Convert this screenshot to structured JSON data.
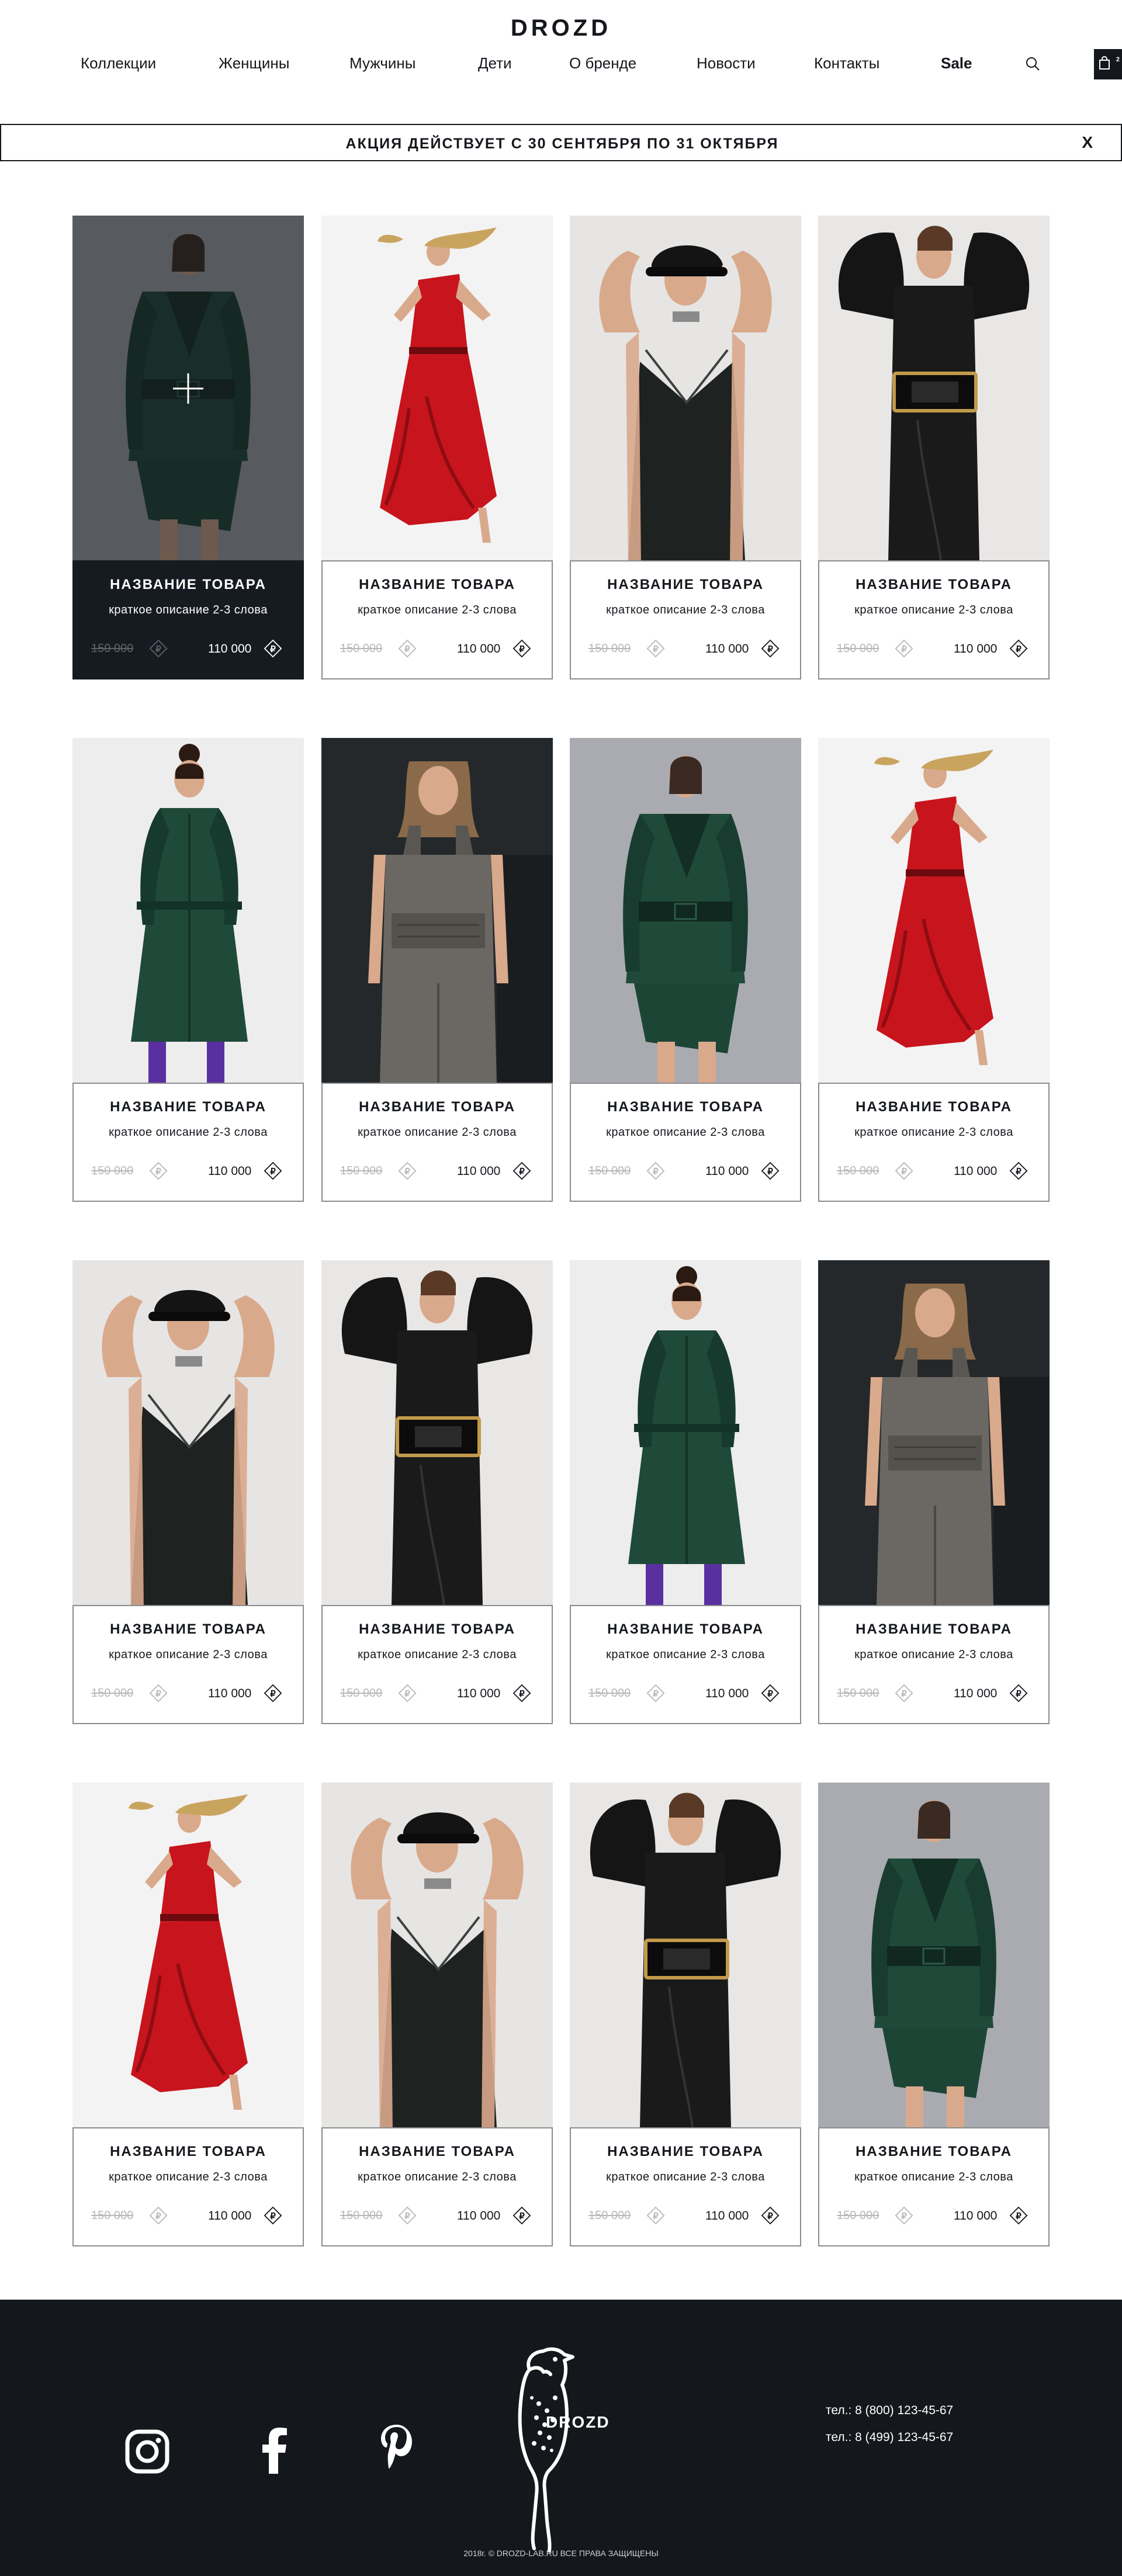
{
  "header": {
    "logo": "DROZD",
    "nav": [
      {
        "label": "Коллекции"
      },
      {
        "label": "Женщины"
      },
      {
        "label": "Мужчины"
      },
      {
        "label": "Дети"
      },
      {
        "label": "О бренде"
      },
      {
        "label": "Новости"
      },
      {
        "label": "Контакты"
      },
      {
        "label": "Sale"
      }
    ],
    "cart_count": "2"
  },
  "promo": {
    "text": "АКЦИЯ ДЕЙСТВУЕТ С 30 СЕНТЯБРЯ ПО 31 ОКТЯБРЯ",
    "close": "X"
  },
  "products": [
    {
      "title": "НАЗВАНИЕ ТОВАРА",
      "desc": "краткое описание 2-3 слова",
      "old_price": "150 000",
      "price": "110 000",
      "image": "green-leather-jacket-skirt"
    },
    {
      "title": "НАЗВАНИЕ ТОВАРА",
      "desc": "краткое описание 2-3 слова",
      "old_price": "150 000",
      "price": "110 000",
      "image": "red-leather-dress"
    },
    {
      "title": "НАЗВАНИЕ ТОВАРА",
      "desc": "краткое описание 2-3 слова",
      "old_price": "150 000",
      "price": "110 000",
      "image": "black-leather-slip-dress-cap"
    },
    {
      "title": "НАЗВАНИЕ ТОВАРА",
      "desc": "краткое описание 2-3 слова",
      "old_price": "150 000",
      "price": "110 000",
      "image": "black-leather-puff-sleeve-dress"
    },
    {
      "title": "НАЗВАНИЕ ТОВАРА",
      "desc": "краткое описание 2-3 слова",
      "old_price": "150 000",
      "price": "110 000",
      "image": "green-leather-trench-coat"
    },
    {
      "title": "НАЗВАНИЕ ТОВАРА",
      "desc": "краткое описание 2-3 слова",
      "old_price": "150 000",
      "price": "110 000",
      "image": "grey-leather-overalls"
    },
    {
      "title": "НАЗВАНИЕ ТОВАРА",
      "desc": "краткое описание 2-3 слова",
      "old_price": "150 000",
      "price": "110 000",
      "image": "green-leather-jacket-skirt"
    },
    {
      "title": "НАЗВАНИЕ ТОВАРА",
      "desc": "краткое описание 2-3 слова",
      "old_price": "150 000",
      "price": "110 000",
      "image": "red-leather-dress"
    },
    {
      "title": "НАЗВАНИЕ ТОВАРА",
      "desc": "краткое описание 2-3 слова",
      "old_price": "150 000",
      "price": "110 000",
      "image": "black-leather-slip-dress-cap"
    },
    {
      "title": "НАЗВАНИЕ ТОВАРА",
      "desc": "краткое описание 2-3 слова",
      "old_price": "150 000",
      "price": "110 000",
      "image": "black-leather-puff-sleeve-dress"
    },
    {
      "title": "НАЗВАНИЕ ТОВАРА",
      "desc": "краткое описание 2-3 слова",
      "old_price": "150 000",
      "price": "110 000",
      "image": "green-leather-trench-coat"
    },
    {
      "title": "НАЗВАНИЕ ТОВАРА",
      "desc": "краткое описание 2-3 слова",
      "old_price": "150 000",
      "price": "110 000",
      "image": "grey-leather-overalls"
    },
    {
      "title": "НАЗВАНИЕ ТОВАРА",
      "desc": "краткое описание 2-3 слова",
      "old_price": "150 000",
      "price": "110 000",
      "image": "red-leather-dress"
    },
    {
      "title": "НАЗВАНИЕ ТОВАРА",
      "desc": "краткое описание 2-3 слова",
      "old_price": "150 000",
      "price": "110 000",
      "image": "black-leather-slip-dress-cap"
    },
    {
      "title": "НАЗВАНИЕ ТОВАРА",
      "desc": "краткое описание 2-3 слова",
      "old_price": "150 000",
      "price": "110 000",
      "image": "black-leather-puff-sleeve-dress"
    },
    {
      "title": "НАЗВАНИЕ ТОВАРА",
      "desc": "краткое описание 2-3 слова",
      "old_price": "150 000",
      "price": "110 000",
      "image": "green-leather-jacket-skirt"
    }
  ],
  "footer": {
    "logo": "DROZD",
    "phones": [
      "тел.: 8 (800) 123-45-67",
      "тел.: 8 (499) 123-45-67"
    ],
    "copyright": "2018г. © DROZD-LAB.RU ВСЕ ПРАВА ЗАЩИЩЕНЫ",
    "social": [
      "instagram-icon",
      "facebook-icon",
      "pinterest-icon"
    ]
  },
  "colors": {
    "dark": "#14171c",
    "border": "#8a8c90",
    "muted_price": "#b8b8b8",
    "red_dress": "#c8141c",
    "green_leather": "#1f4a3a"
  }
}
